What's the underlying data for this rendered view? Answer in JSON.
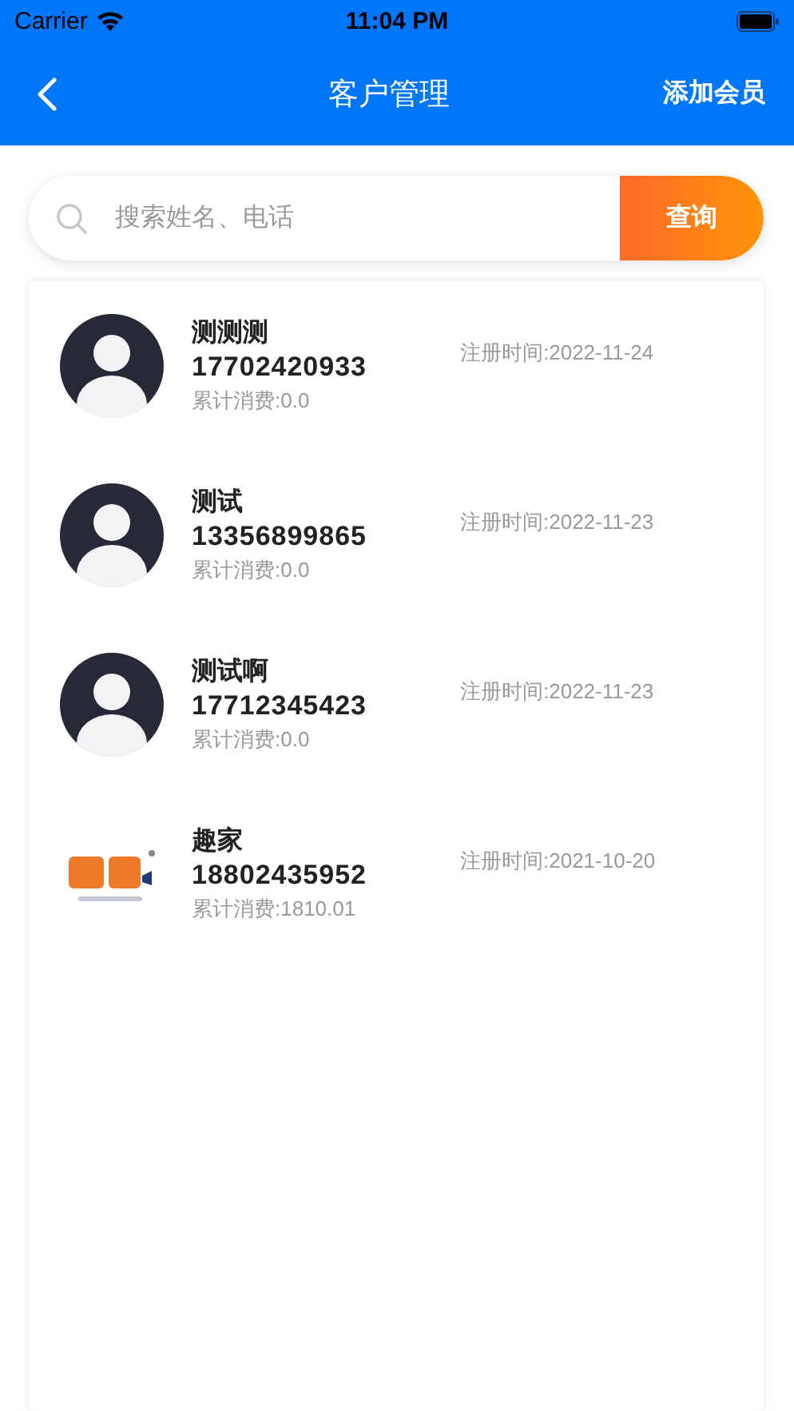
{
  "status_bar": {
    "carrier": "Carrier",
    "time": "11:04 PM"
  },
  "nav_bar": {
    "title": "客户管理",
    "action": "添加会员"
  },
  "search": {
    "placeholder": "搜索姓名、电话",
    "button": "查询"
  },
  "customers": [
    {
      "kind": "default",
      "name": "测测测",
      "phone": "17702420933",
      "spending": "累计消费:0.0",
      "registered": "注册时间:2022-11-24"
    },
    {
      "kind": "default",
      "name": "测试",
      "phone": "13356899865",
      "spending": "累计消费:0.0",
      "registered": "注册时间:2022-11-23"
    },
    {
      "kind": "default",
      "name": "测试啊",
      "phone": "17712345423",
      "spending": "累计消费:0.0",
      "registered": "注册时间:2022-11-23"
    },
    {
      "kind": "picture",
      "name": "趣家",
      "phone": "18802435952",
      "spending": "累计消费:1810.01",
      "registered": "注册时间:2021-10-20"
    }
  ]
}
